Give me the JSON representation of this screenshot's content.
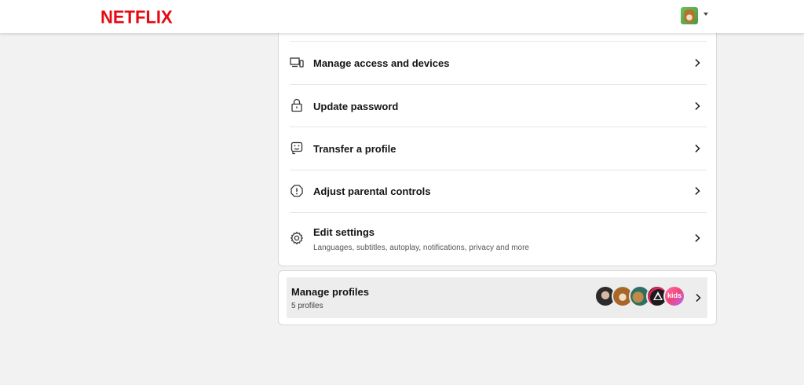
{
  "header": {
    "logo_text": "NETFLIX",
    "logo_color": "#e50914",
    "account_avatar_icon": "dog-avatar-icon",
    "account_menu_icon": "caret-down-icon"
  },
  "settings_rows": [
    {
      "icon": "devices-icon",
      "label": "Manage access and devices",
      "chevron_icon": "chevron-right-icon"
    },
    {
      "icon": "lock-icon",
      "label": "Update password",
      "chevron_icon": "chevron-right-icon"
    },
    {
      "icon": "transfer-profile-icon",
      "label": "Transfer a profile",
      "chevron_icon": "chevron-right-icon"
    },
    {
      "icon": "warning-octagon-icon",
      "label": "Adjust parental controls",
      "chevron_icon": "chevron-right-icon"
    },
    {
      "icon": "gear-icon",
      "label": "Edit settings",
      "sub": "Languages, subtitles, autoplay, notifications, privacy and more",
      "chevron_icon": "chevron-right-icon"
    }
  ],
  "profiles": {
    "title": "Manage profiles",
    "count_text": "5 profiles",
    "avatars": [
      "profile-avatar-1",
      "profile-avatar-2",
      "profile-avatar-3",
      "profile-avatar-4",
      "profile-avatar-kids"
    ],
    "kids_label": "kids",
    "chevron_icon": "chevron-right-icon"
  }
}
